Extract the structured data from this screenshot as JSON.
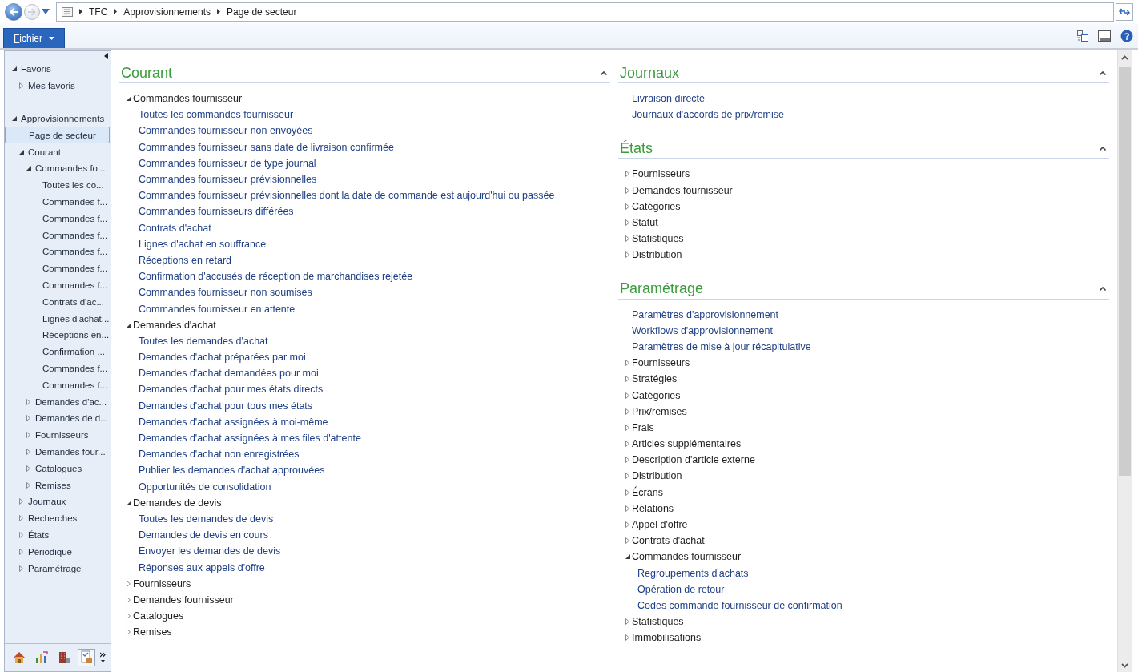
{
  "address_bar": {
    "breadcrumb": [
      "TFC",
      "Approvisionnements",
      "Page de secteur"
    ]
  },
  "ribbon": {
    "tab": "Fichier"
  },
  "sidebar": {
    "items": [
      {
        "label": "Favoris",
        "selected": false,
        "expanded": true,
        "children": [
          {
            "label": "Mes favoris",
            "selected": false,
            "expanded": false
          }
        ]
      },
      {
        "label": "Approvisionnements",
        "selected": false,
        "expanded": true,
        "children": [
          {
            "label": "Page de secteur",
            "selected": true
          },
          {
            "label": "Courant",
            "selected": false,
            "expanded": true,
            "children": [
              {
                "label": "Commandes fo...",
                "selected": false,
                "expanded": true,
                "children": [
                  {
                    "label": "Toutes les co...",
                    "selected": false
                  },
                  {
                    "label": "Commandes f...",
                    "selected": false
                  },
                  {
                    "label": "Commandes f...",
                    "selected": false
                  },
                  {
                    "label": "Commandes f...",
                    "selected": false
                  },
                  {
                    "label": "Commandes f...",
                    "selected": false
                  },
                  {
                    "label": "Commandes f...",
                    "selected": false
                  },
                  {
                    "label": "Commandes f...",
                    "selected": false
                  },
                  {
                    "label": "Contrats d'ac...",
                    "selected": false
                  },
                  {
                    "label": "Lignes d'achat...",
                    "selected": false
                  },
                  {
                    "label": "Réceptions en...",
                    "selected": false
                  },
                  {
                    "label": "Confirmation ...",
                    "selected": false
                  },
                  {
                    "label": "Commandes f...",
                    "selected": false
                  },
                  {
                    "label": "Commandes f...",
                    "selected": false
                  }
                ]
              },
              {
                "label": "Demandes d'ac...",
                "selected": false,
                "expanded": false
              },
              {
                "label": "Demandes de d...",
                "selected": false,
                "expanded": false
              },
              {
                "label": "Fournisseurs",
                "selected": false,
                "expanded": false
              },
              {
                "label": "Demandes four...",
                "selected": false,
                "expanded": false
              },
              {
                "label": "Catalogues",
                "selected": false,
                "expanded": false
              },
              {
                "label": "Remises",
                "selected": false,
                "expanded": false
              }
            ]
          },
          {
            "label": "Journaux",
            "selected": false,
            "expanded": false
          },
          {
            "label": "Recherches",
            "selected": false,
            "expanded": false
          },
          {
            "label": "États",
            "selected": false,
            "expanded": false
          },
          {
            "label": "Périodique",
            "selected": false,
            "expanded": false
          },
          {
            "label": "Paramétrage",
            "selected": false,
            "expanded": false
          }
        ]
      }
    ]
  },
  "columns": [
    {
      "sections": [
        {
          "title": "Courant",
          "expanded": true,
          "items": [
            {
              "kind": "group",
              "label": "Commandes fournisseur",
              "expanded": true,
              "children": [
                {
                  "kind": "link",
                  "label": "Toutes les commandes fournisseur"
                },
                {
                  "kind": "link",
                  "label": "Commandes fournisseur non envoyées"
                },
                {
                  "kind": "link",
                  "label": "Commandes fournisseur sans date de livraison confirmée"
                },
                {
                  "kind": "link",
                  "label": "Commandes fournisseur de type journal"
                },
                {
                  "kind": "link",
                  "label": "Commandes fournisseur prévisionnelles"
                },
                {
                  "kind": "link",
                  "label": "Commandes fournisseur prévisionnelles dont la date de commande est aujourd'hui ou passée"
                },
                {
                  "kind": "link",
                  "label": "Commandes fournisseurs différées"
                },
                {
                  "kind": "link",
                  "label": "Contrats d'achat"
                },
                {
                  "kind": "link",
                  "label": "Lignes d'achat en souffrance"
                },
                {
                  "kind": "link",
                  "label": "Réceptions en retard"
                },
                {
                  "kind": "link",
                  "label": "Confirmation d'accusés de réception de marchandises rejetée"
                },
                {
                  "kind": "link",
                  "label": "Commandes fournisseur non soumises"
                },
                {
                  "kind": "link",
                  "label": "Commandes fournisseur en attente"
                }
              ]
            },
            {
              "kind": "group",
              "label": "Demandes d'achat",
              "expanded": true,
              "children": [
                {
                  "kind": "link",
                  "label": "Toutes les demandes d'achat"
                },
                {
                  "kind": "link",
                  "label": "Demandes d'achat préparées par moi"
                },
                {
                  "kind": "link",
                  "label": "Demandes d'achat demandées pour moi"
                },
                {
                  "kind": "link",
                  "label": "Demandes d'achat pour mes états directs"
                },
                {
                  "kind": "link",
                  "label": "Demandes d'achat pour tous mes états"
                },
                {
                  "kind": "link",
                  "label": "Demandes d'achat assignées à moi-même"
                },
                {
                  "kind": "link",
                  "label": "Demandes d'achat assignées à mes files d'attente"
                },
                {
                  "kind": "link",
                  "label": "Demandes d'achat non enregistrées"
                },
                {
                  "kind": "link",
                  "label": "Publier les demandes d'achat approuvées"
                },
                {
                  "kind": "link",
                  "label": "Opportunités de consolidation"
                }
              ]
            },
            {
              "kind": "group",
              "label": "Demandes de devis",
              "expanded": true,
              "children": [
                {
                  "kind": "link",
                  "label": "Toutes les demandes de devis"
                },
                {
                  "kind": "link",
                  "label": "Demandes de devis en cours"
                },
                {
                  "kind": "link",
                  "label": "Envoyer les demandes de devis"
                },
                {
                  "kind": "link",
                  "label": "Réponses aux appels d'offre"
                }
              ]
            },
            {
              "kind": "group",
              "label": "Fournisseurs",
              "expanded": false
            },
            {
              "kind": "group",
              "label": "Demandes fournisseur",
              "expanded": false
            },
            {
              "kind": "group",
              "label": "Catalogues",
              "expanded": false
            },
            {
              "kind": "group",
              "label": "Remises",
              "expanded": false
            }
          ]
        }
      ]
    },
    {
      "sections": [
        {
          "title": "Journaux",
          "expanded": true,
          "items": [
            {
              "kind": "link",
              "label": "Livraison directe"
            },
            {
              "kind": "link",
              "label": "Journaux d'accords de prix/remise"
            }
          ]
        },
        {
          "title": "États",
          "expanded": true,
          "items": [
            {
              "kind": "group",
              "label": "Fournisseurs",
              "expanded": false
            },
            {
              "kind": "group",
              "label": "Demandes fournisseur",
              "expanded": false
            },
            {
              "kind": "group",
              "label": "Catégories",
              "expanded": false
            },
            {
              "kind": "group",
              "label": "Statut",
              "expanded": false
            },
            {
              "kind": "group",
              "label": "Statistiques",
              "expanded": false
            },
            {
              "kind": "group",
              "label": "Distribution",
              "expanded": false
            }
          ]
        },
        {
          "title": "Paramétrage",
          "expanded": true,
          "items": [
            {
              "kind": "link",
              "label": "Paramètres d'approvisionnement"
            },
            {
              "kind": "link",
              "label": "Workflows d'approvisionnement"
            },
            {
              "kind": "link",
              "label": "Paramètres de mise à jour récapitulative"
            },
            {
              "kind": "group",
              "label": "Fournisseurs",
              "expanded": false
            },
            {
              "kind": "group",
              "label": "Stratégies",
              "expanded": false
            },
            {
              "kind": "group",
              "label": "Catégories",
              "expanded": false
            },
            {
              "kind": "group",
              "label": "Prix/remises",
              "expanded": false
            },
            {
              "kind": "group",
              "label": "Frais",
              "expanded": false
            },
            {
              "kind": "group",
              "label": "Articles supplémentaires",
              "expanded": false
            },
            {
              "kind": "group",
              "label": "Description d'article externe",
              "expanded": false
            },
            {
              "kind": "group",
              "label": "Distribution",
              "expanded": false
            },
            {
              "kind": "group",
              "label": "Écrans",
              "expanded": false
            },
            {
              "kind": "group",
              "label": "Relations",
              "expanded": false
            },
            {
              "kind": "group",
              "label": "Appel d'offre",
              "expanded": false
            },
            {
              "kind": "group",
              "label": "Contrats d'achat",
              "expanded": false
            },
            {
              "kind": "group",
              "label": "Commandes fournisseur",
              "expanded": true,
              "children": [
                {
                  "kind": "link",
                  "label": "Regroupements d'achats"
                },
                {
                  "kind": "link",
                  "label": "Opération de retour"
                },
                {
                  "kind": "link",
                  "label": "Codes commande fournisseur de confirmation"
                }
              ]
            },
            {
              "kind": "group",
              "label": "Statistiques",
              "expanded": false
            },
            {
              "kind": "group",
              "label": "Immobilisations",
              "expanded": false
            }
          ]
        }
      ]
    }
  ]
}
